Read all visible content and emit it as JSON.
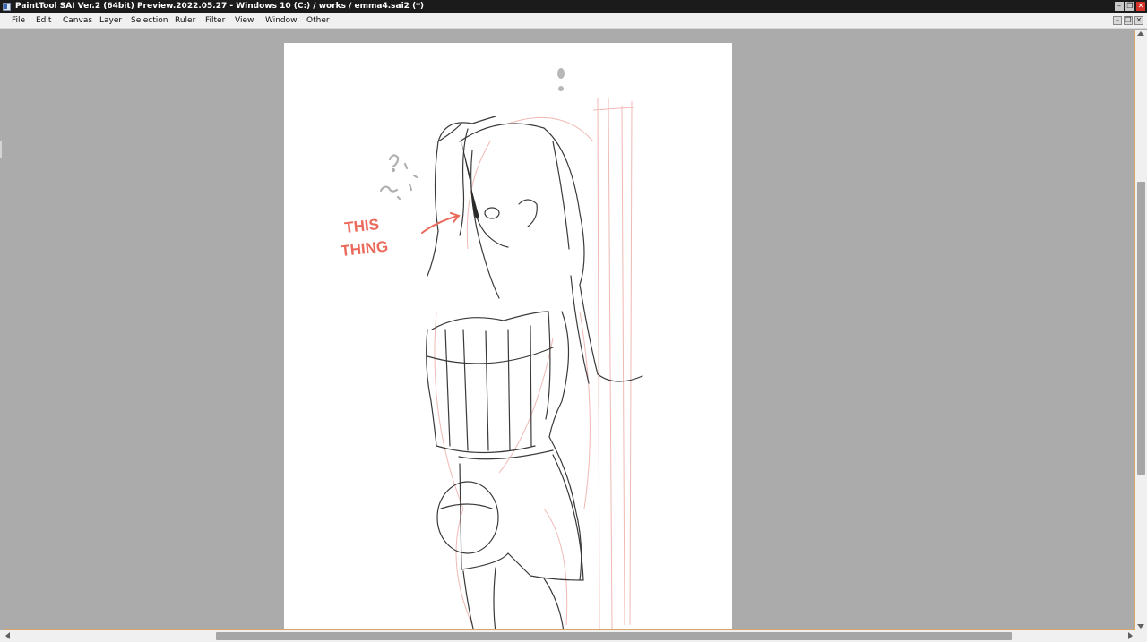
{
  "window": {
    "title": "PaintTool SAI Ver.2 (64bit) Preview.2022.05.27 - Windows 10 (C:) / works / emma4.sai2 (*)",
    "minimize_glyph": "–",
    "maximize_glyph": "❐",
    "close_glyph": "✕"
  },
  "menubar": {
    "items": [
      {
        "label": "File"
      },
      {
        "label": "Edit"
      },
      {
        "label": "Canvas"
      },
      {
        "label": "Layer"
      },
      {
        "label": "Selection"
      },
      {
        "label": "Ruler"
      },
      {
        "label": "Filter"
      },
      {
        "label": "View"
      },
      {
        "label": "Window"
      },
      {
        "label": "Other"
      }
    ]
  },
  "document": {
    "annotation_text_line1": "THIS",
    "annotation_text_line2": "THING",
    "annotation_color": "#ea6a5c",
    "lineart_color": "#3a3a3a",
    "sketch_color": "#f0b9b4"
  },
  "colors": {
    "background": "#ababab",
    "titlebar": "#1b1b1b",
    "close_button": "#d6342a",
    "canvas_border": "#d5a86a"
  }
}
